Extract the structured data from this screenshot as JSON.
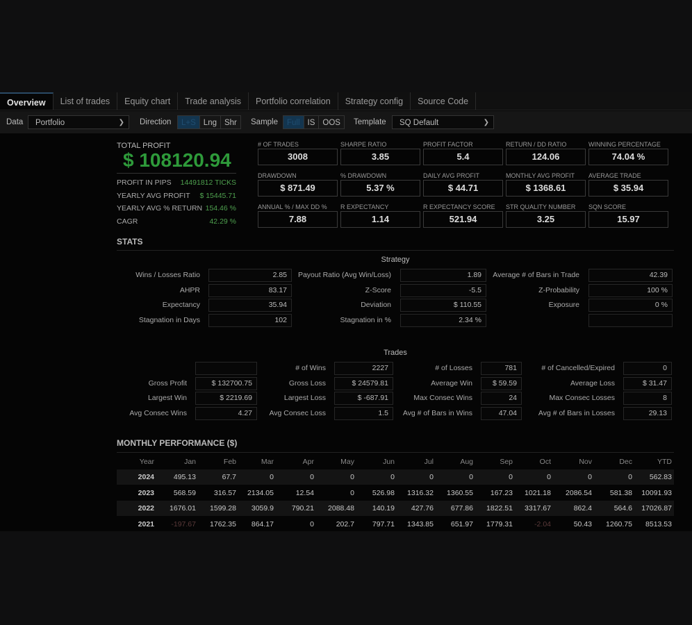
{
  "tabs": [
    "Overview",
    "List of trades",
    "Equity chart",
    "Trade analysis",
    "Portfolio correlation",
    "Strategy config",
    "Source Code"
  ],
  "toolbar": {
    "data_label": "Data",
    "data_value": "Portfolio",
    "direction_label": "Direction",
    "direction_options": [
      "L+S",
      "Lng",
      "Shr"
    ],
    "direction_selected": "L+S",
    "sample_label": "Sample",
    "sample_options": [
      "Full",
      "IS",
      "OOS"
    ],
    "sample_selected": "Full",
    "template_label": "Template",
    "template_value": "SQ Default"
  },
  "summary": {
    "total_profit_label": "TOTAL PROFIT",
    "total_profit": "$ 108120.94",
    "rows": [
      {
        "label": "PROFIT IN PIPS",
        "value": "14491812 TICKS"
      },
      {
        "label": "YEARLY AVG PROFIT",
        "value": "$ 15445.71"
      },
      {
        "label": "YEARLY AVG % RETURN",
        "value": "154.46 %"
      },
      {
        "label": "CAGR",
        "value": "42.29 %"
      }
    ]
  },
  "metrics": [
    {
      "label": "# OF TRADES",
      "value": "3008"
    },
    {
      "label": "SHARPE RATIO",
      "value": "3.85"
    },
    {
      "label": "PROFIT FACTOR",
      "value": "5.4"
    },
    {
      "label": "RETURN / DD RATIO",
      "value": "124.06"
    },
    {
      "label": "WINNING PERCENTAGE",
      "value": "74.04 %"
    },
    {
      "label": "DRAWDOWN",
      "value": "$ 871.49"
    },
    {
      "label": "% DRAWDOWN",
      "value": "5.37 %"
    },
    {
      "label": "DAILY AVG PROFIT",
      "value": "$ 44.71"
    },
    {
      "label": "MONTHLY AVG PROFIT",
      "value": "$ 1368.61"
    },
    {
      "label": "AVERAGE TRADE",
      "value": "$ 35.94"
    },
    {
      "label": "ANNUAL % / MAX DD %",
      "value": "7.88"
    },
    {
      "label": "R EXPECTANCY",
      "value": "1.14"
    },
    {
      "label": "R EXPECTANCY SCORE",
      "value": "521.94"
    },
    {
      "label": "STR QUALITY NUMBER",
      "value": "3.25"
    },
    {
      "label": "SQN SCORE",
      "value": "15.97"
    }
  ],
  "stats": {
    "title": "STATS",
    "strategy_title": "Strategy",
    "strategy": [
      [
        {
          "label": "Wins / Losses Ratio",
          "value": "2.85"
        },
        {
          "label": "Payout Ratio (Avg Win/Loss)",
          "value": "1.89"
        },
        {
          "label": "Average # of Bars in Trade",
          "value": "42.39"
        }
      ],
      [
        {
          "label": "AHPR",
          "value": "83.17"
        },
        {
          "label": "Z-Score",
          "value": "-5.5"
        },
        {
          "label": "Z-Probability",
          "value": "100 %"
        }
      ],
      [
        {
          "label": "Expectancy",
          "value": "35.94"
        },
        {
          "label": "Deviation",
          "value": "$ 110.55"
        },
        {
          "label": "Exposure",
          "value": "0 %"
        }
      ],
      [
        {
          "label": "Stagnation in Days",
          "value": "102"
        },
        {
          "label": "Stagnation in %",
          "value": "2.34 %"
        },
        {
          "label": "",
          "value": ""
        }
      ]
    ],
    "trades_title": "Trades",
    "trades": [
      [
        {
          "label": "",
          "value": ""
        },
        {
          "label": "# of Wins",
          "value": "2227"
        },
        {
          "label": "# of Losses",
          "value": "781"
        },
        {
          "label": "# of Cancelled/Expired",
          "value": "0"
        }
      ],
      [
        {
          "label": "Gross Profit",
          "value": "$ 132700.75"
        },
        {
          "label": "Gross Loss",
          "value": "$ 24579.81"
        },
        {
          "label": "Average Win",
          "value": "$ 59.59"
        },
        {
          "label": "Average Loss",
          "value": "$ 31.47"
        }
      ],
      [
        {
          "label": "Largest Win",
          "value": "$ 2219.69"
        },
        {
          "label": "Largest Loss",
          "value": "$ -687.91"
        },
        {
          "label": "Max Consec Wins",
          "value": "24"
        },
        {
          "label": "Max Consec Losses",
          "value": "8"
        }
      ],
      [
        {
          "label": "Avg Consec Wins",
          "value": "4.27"
        },
        {
          "label": "Avg Consec Loss",
          "value": "1.5"
        },
        {
          "label": "Avg # of Bars in Wins",
          "value": "47.04"
        },
        {
          "label": "Avg # of Bars in Losses",
          "value": "29.13"
        }
      ]
    ]
  },
  "monthly": {
    "title": "MONTHLY PERFORMANCE ($)",
    "headers": [
      "Year",
      "Jan",
      "Feb",
      "Mar",
      "Apr",
      "May",
      "Jun",
      "Jul",
      "Aug",
      "Sep",
      "Oct",
      "Nov",
      "Dec",
      "YTD"
    ],
    "rows": [
      [
        "2024",
        "495.13",
        "67.7",
        "0",
        "0",
        "0",
        "0",
        "0",
        "0",
        "0",
        "0",
        "0",
        "0",
        "562.83"
      ],
      [
        "2023",
        "568.59",
        "316.57",
        "2134.05",
        "12.54",
        "0",
        "526.98",
        "1316.32",
        "1360.55",
        "167.23",
        "1021.18",
        "2086.54",
        "581.38",
        "10091.93"
      ],
      [
        "2022",
        "1676.01",
        "1599.28",
        "3059.9",
        "790.21",
        "2088.48",
        "140.19",
        "427.76",
        "677.86",
        "1822.51",
        "3317.67",
        "862.4",
        "564.6",
        "17026.87"
      ],
      [
        "2021",
        "-197.67",
        "1762.35",
        "864.17",
        "0",
        "202.7",
        "797.71",
        "1343.85",
        "651.97",
        "1779.31",
        "-2.04",
        "50.43",
        "1260.75",
        "8513.53"
      ]
    ]
  },
  "colors": {
    "profit_green": "#2e9a3a",
    "selected_segment": "#13354f",
    "negative": "#5a3a3a"
  }
}
